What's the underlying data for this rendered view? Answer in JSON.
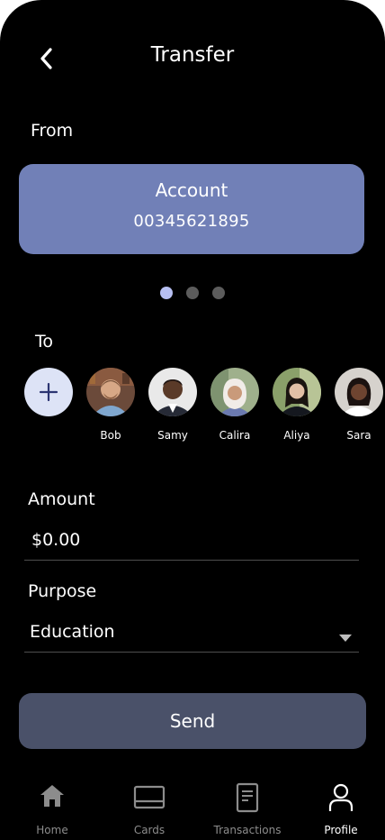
{
  "header": {
    "title": "Transfer"
  },
  "from": {
    "label": "From",
    "account_name": "Account",
    "account_number": "00345621895",
    "pages": 3,
    "active_page": 0
  },
  "to": {
    "label": "To",
    "contacts": [
      {
        "name": "Bob"
      },
      {
        "name": "Samy"
      },
      {
        "name": "Calira"
      },
      {
        "name": "Aliya"
      },
      {
        "name": "Sara"
      }
    ]
  },
  "amount": {
    "label": "Amount",
    "value": "$0.00"
  },
  "purpose": {
    "label": "Purpose",
    "value": "Education"
  },
  "send_label": "Send",
  "nav": {
    "items": [
      {
        "label": "Home",
        "icon": "home-icon"
      },
      {
        "label": "Cards",
        "icon": "card-icon"
      },
      {
        "label": "Transactions",
        "icon": "document-icon"
      },
      {
        "label": "Profile",
        "icon": "user-icon"
      }
    ],
    "active": "Profile"
  }
}
